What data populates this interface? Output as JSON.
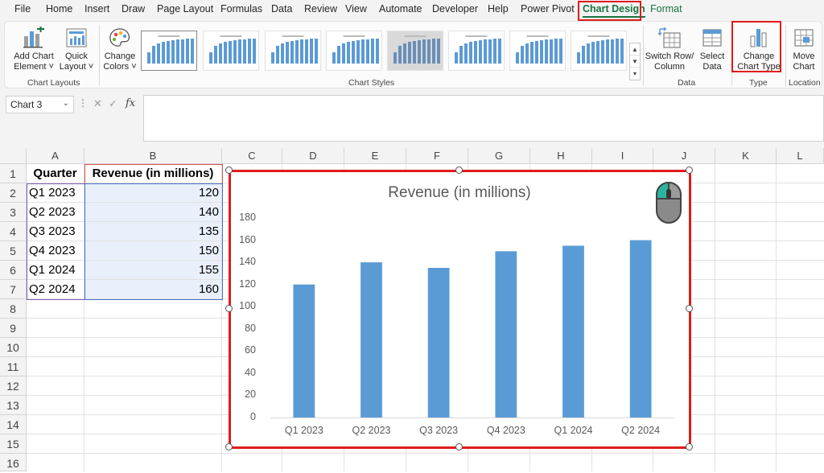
{
  "tabs": [
    "File",
    "Home",
    "Insert",
    "Draw",
    "Page Layout",
    "Formulas",
    "Data",
    "Review",
    "View",
    "Automate",
    "Developer",
    "Help",
    "Power Pivot",
    "Chart Design",
    "Format"
  ],
  "active_tab": "Chart Design",
  "ribbon": {
    "add_chart_element": [
      "Add Chart",
      "Element ˅"
    ],
    "quick_layout": [
      "Quick",
      "Layout ˅"
    ],
    "change_colors": [
      "Change",
      "Colors ˅"
    ],
    "switch_row_column": [
      "Switch Row/",
      "Column"
    ],
    "select_data": [
      "Select",
      "Data"
    ],
    "change_chart_type": [
      "Change",
      "Chart Type"
    ],
    "move_chart": [
      "Move",
      "Chart"
    ],
    "groups": {
      "chart_layouts": "Chart Layouts",
      "chart_styles": "Chart Styles",
      "data": "Data",
      "type": "Type",
      "location": "Location"
    },
    "style_thumbnails": 8
  },
  "formula_bar": {
    "name_box": "Chart 3",
    "formula": ""
  },
  "columns": [
    "A",
    "B",
    "C",
    "D",
    "E",
    "F",
    "G",
    "H",
    "I",
    "J",
    "K",
    "L"
  ],
  "rows": [
    "1",
    "2",
    "3",
    "4",
    "5",
    "6",
    "7",
    "8",
    "9",
    "10",
    "11",
    "12",
    "13",
    "14",
    "15",
    "16"
  ],
  "table": {
    "headers": [
      "Quarter",
      "Revenue (in millions)"
    ],
    "rows": [
      [
        "Q1 2023",
        "120"
      ],
      [
        "Q2 2023",
        "140"
      ],
      [
        "Q3 2023",
        "135"
      ],
      [
        "Q4 2023",
        "150"
      ],
      [
        "Q1 2024",
        "155"
      ],
      [
        "Q2 2024",
        "160"
      ]
    ]
  },
  "colors": {
    "accent_green": "#1a7343",
    "highlight_red": "#e01b1b",
    "bar_blue": "#5b9bd5"
  },
  "chart_data": {
    "type": "bar",
    "title": "Revenue (in millions)",
    "categories": [
      "Q1 2023",
      "Q2 2023",
      "Q3 2023",
      "Q4 2023",
      "Q1 2024",
      "Q2 2024"
    ],
    "values": [
      120,
      140,
      135,
      150,
      155,
      160
    ],
    "ylim": [
      0,
      180
    ],
    "yticks": [
      0,
      20,
      40,
      60,
      80,
      100,
      120,
      140,
      160,
      180
    ],
    "xlabel": "",
    "ylabel": "",
    "grid": false,
    "legend": "none",
    "color": "#5b9bd5"
  }
}
